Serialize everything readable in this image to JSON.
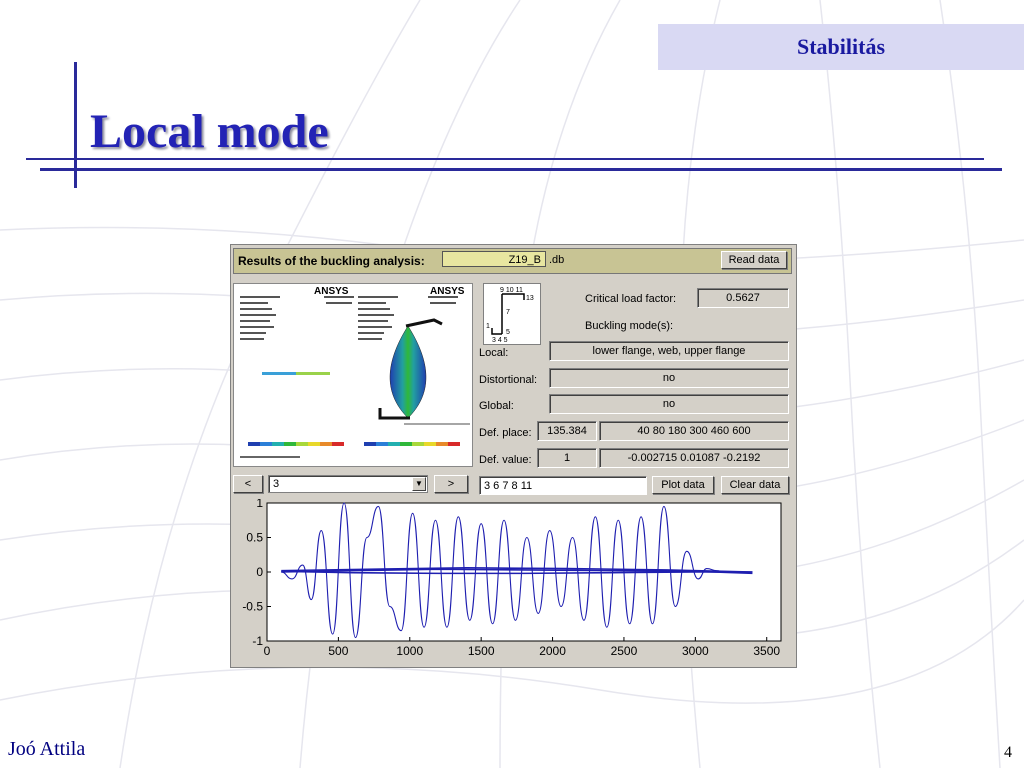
{
  "header": {
    "topic": "Stabilitás",
    "title": "Local mode"
  },
  "footer": {
    "author": "Joó Attila",
    "page": "4"
  },
  "app": {
    "results_label": "Results of the buckling analysis:",
    "filename": "Z19_B",
    "extension": ".db",
    "read_button": "Read data",
    "thumb_logo_left": "ANSYS",
    "thumb_logo_right": "ANSYS",
    "section_nodes": {
      "top": "9 10 11",
      "mid": "7",
      "right": "13",
      "left": "1",
      "bottom_right": "5",
      "bottom": "3 4 5"
    },
    "critical_label": "Critical load factor:",
    "critical_value": "0.5627",
    "buckling_label": "Buckling mode(s):",
    "local_label": "Local:",
    "local_value": "lower flange, web, upper flange",
    "distortional_label": "Distortional:",
    "distortional_value": "no",
    "global_label": "Global:",
    "global_value": "no",
    "defplace_label": "Def. place:",
    "defplace_first": "135.384",
    "defplace_rest": "40   80  180  300  460  600",
    "defvalue_label": "Def. value:",
    "defvalue_first": "1",
    "defvalue_rest": "-0.002715   0.01087   -0.2192",
    "prev_button": "<",
    "next_button": ">",
    "mode_select": "3",
    "nodes_input": "3 6 7 8 11",
    "plot_button": "Plot data",
    "clear_button": "Clear data"
  },
  "colors": {
    "accent": "#2323b5",
    "panel": "#d4d0c8",
    "titlebar": "#c8c494",
    "series": "#1f1fb0"
  },
  "chart_data": {
    "type": "line",
    "xlim": [
      0,
      3600
    ],
    "ylim": [
      -1,
      1
    ],
    "xticks": [
      0,
      500,
      1000,
      1500,
      2000,
      2500,
      3000,
      3500
    ],
    "yticks": [
      1,
      0.5,
      0,
      -0.5,
      -1
    ],
    "xtick_labels": [
      "0",
      "500",
      "1000",
      "1500",
      "2000",
      "2500",
      "3000",
      "3500"
    ],
    "ytick_labels": [
      "1",
      "0.5",
      "0",
      "-0.5",
      "-1"
    ],
    "grid": false,
    "series": [
      {
        "x": [
          100,
          175,
          250,
          310,
          380,
          460,
          540,
          620,
          700,
          780,
          860,
          940,
          1020,
          1100,
          1180,
          1260,
          1340,
          1420,
          1500,
          1580,
          1660,
          1740,
          1820,
          1900,
          1980,
          2060,
          2140,
          2220,
          2300,
          2380,
          2460,
          2540,
          2620,
          2700,
          2780,
          2860,
          2940,
          3020,
          3080,
          3150,
          3200,
          3260,
          3330,
          3400
        ],
        "y": [
          0,
          -0.1,
          0.1,
          -0.4,
          0.6,
          -0.9,
          1.0,
          -0.95,
          0.5,
          0.95,
          -0.5,
          -0.85,
          0.85,
          -0.8,
          0.75,
          -0.8,
          0.8,
          -0.7,
          0.7,
          -0.75,
          0.75,
          -0.7,
          0.5,
          -0.6,
          0.6,
          -0.5,
          0.5,
          -0.7,
          0.8,
          -0.8,
          0.75,
          -0.75,
          0.8,
          -0.75,
          0.95,
          -0.5,
          0.3,
          -0.1,
          0.05,
          0.02,
          0.0,
          0.0,
          0.0,
          0.0
        ]
      },
      {
        "x": [
          100,
          600,
          1200,
          1800,
          2400,
          3000,
          3400
        ],
        "y": [
          0.0,
          0.02,
          0.04,
          0.03,
          0.02,
          0.01,
          -0.02
        ]
      },
      {
        "x": [
          100,
          600,
          1200,
          1800,
          2400,
          3000,
          3400
        ],
        "y": [
          0.01,
          -0.01,
          -0.02,
          -0.02,
          -0.01,
          0.0,
          0.0
        ]
      },
      {
        "x": [
          100,
          700,
          1400,
          2100,
          2800,
          3400
        ],
        "y": [
          0.02,
          0.04,
          0.06,
          0.05,
          0.03,
          0.0
        ]
      }
    ]
  }
}
